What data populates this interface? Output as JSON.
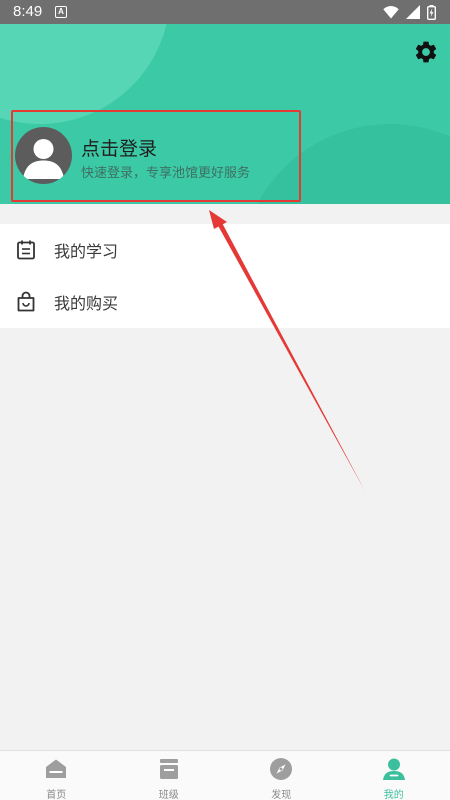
{
  "status_bar": {
    "time": "8:49",
    "notification_letter": "A",
    "icons": [
      "wifi-icon",
      "signal-icon",
      "battery-charging-icon"
    ]
  },
  "header": {
    "settings_icon": "gear-icon",
    "login_card": {
      "title": "点击登录",
      "subtitle": "快速登录，专享池馆更好服务",
      "avatar_icon": "default-avatar-icon"
    }
  },
  "menu": {
    "items": [
      {
        "label": "我的学习",
        "icon": "calendar-list-icon"
      },
      {
        "label": "我的购买",
        "icon": "shopping-bag-icon"
      }
    ]
  },
  "tabbar": {
    "tabs": [
      {
        "label": "首页",
        "icon": "home-icon",
        "active": false
      },
      {
        "label": "班级",
        "icon": "class-icon",
        "active": false
      },
      {
        "label": "发现",
        "icon": "compass-icon",
        "active": false
      },
      {
        "label": "我的",
        "icon": "profile-icon",
        "active": true
      }
    ]
  },
  "colors": {
    "brand": "#3ccaa6",
    "active_tab": "#3cbf9d",
    "annotation": "#e53935",
    "status_bar": "#6f6f6f"
  }
}
